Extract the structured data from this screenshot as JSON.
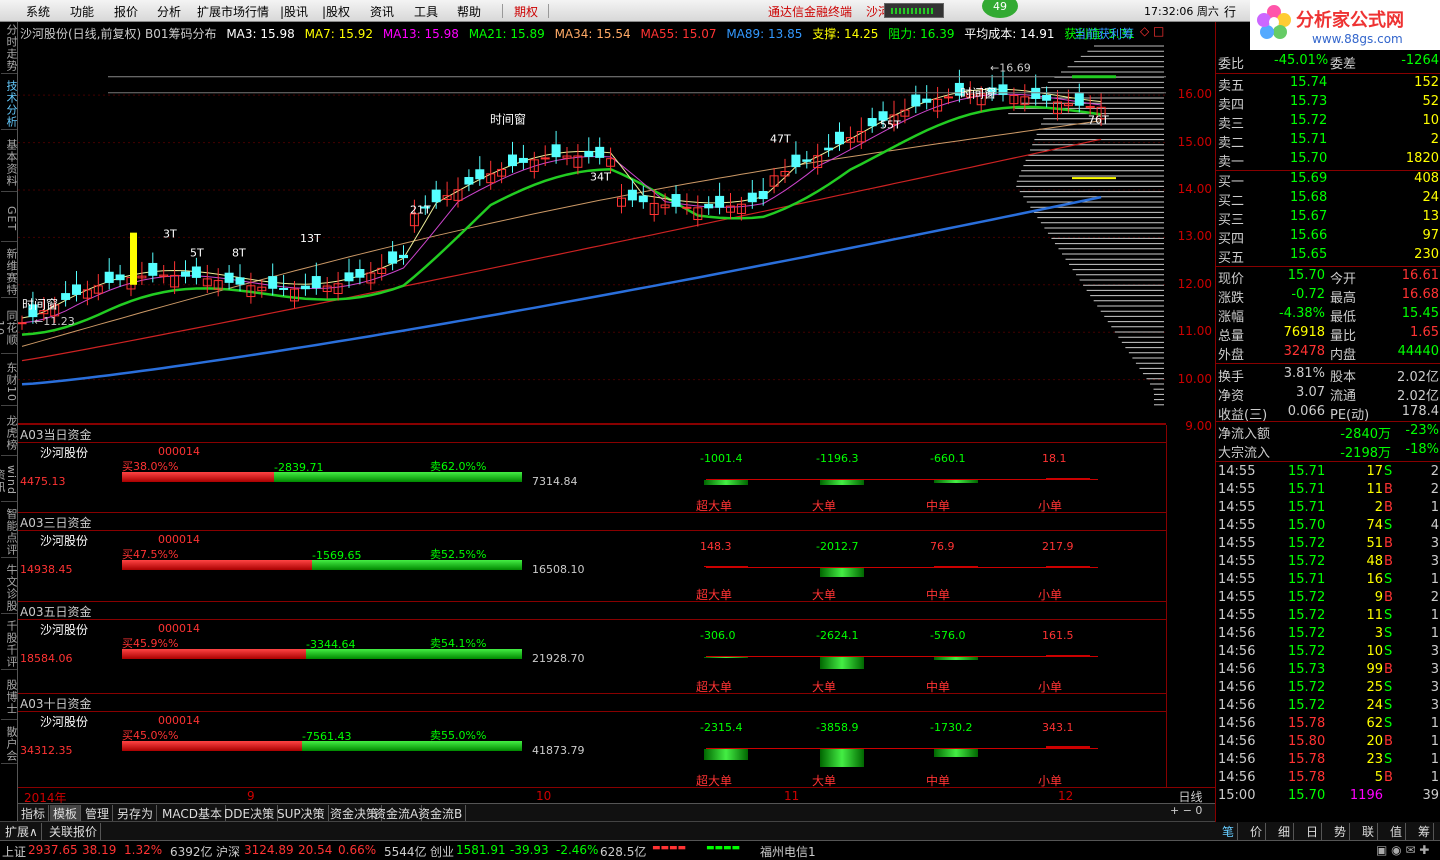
{
  "menu": {
    "items": [
      "系统",
      "功能",
      "报价",
      "分析",
      "扩展市场行情",
      "|股讯",
      "|股权",
      "资讯",
      "工具",
      "帮助"
    ],
    "option_tab": "期权",
    "broker_label": "通达信金融终端",
    "stock_short": "沙河",
    "clock": "17:32:06 周六",
    "trade_btn": "行",
    "badge": "49"
  },
  "logo": {
    "text": "分析家公式网",
    "url": "www.88gs.com"
  },
  "side_tabs": [
    "分时走势",
    "技术分析",
    "基本资料",
    "GET",
    "新维赛特",
    "同花顺10",
    "东财10",
    "龙虎榜",
    "wind资讯",
    "智能点评",
    "牛文诊股",
    "千股千评",
    "股博士",
    "散户会"
  ],
  "header": {
    "title": "沙河股份(日线,前复权) B01筹码分布",
    "ma3": "MA3: 15.98",
    "ma7": "MA7: 15.92",
    "ma13": "MA13: 15.98",
    "ma21": "MA21: 15.89",
    "ma34": "MA34: 15.54",
    "ma55": "MA55: 15.07",
    "ma89": "MA89: 13.85",
    "support": "支撑: 14.25",
    "resist": "阻力: 16.39",
    "avgcost": "平均成本: 14.91",
    "profit": "获利值: 5.31",
    "current_profit": "当前获利筹"
  },
  "price_labels": [
    "16.00",
    "15.00",
    "14.00",
    "13.00",
    "12.00",
    "11.00",
    "10.00",
    "9.00"
  ],
  "chart_annotations": {
    "high": "16.69",
    "low": "11.23",
    "t_labels": [
      "3T",
      "5T",
      "8T",
      "13T",
      "21T",
      "34T",
      "47T",
      "55T",
      "76T"
    ],
    "window_label": "时间窗"
  },
  "chart_data": {
    "type": "line",
    "title": "沙河股份(日线,前复权)",
    "x": [
      "2014-08",
      "2014-09",
      "2014-10",
      "2014-11",
      "2014-12"
    ],
    "series": [
      {
        "name": "close",
        "values": [
          11.2,
          12.7,
          14.3,
          15.9,
          15.7
        ]
      },
      {
        "name": "MA89",
        "values": [
          9.9,
          10.6,
          11.6,
          12.6,
          13.85
        ]
      }
    ],
    "ylim": [
      9,
      16.7
    ]
  },
  "quote": {
    "weibi_label": "委比",
    "weibi": "-45.01%",
    "weicha_label": "委差",
    "weicha": "-1264",
    "asks": [
      {
        "label": "卖五",
        "price": "15.74",
        "vol": "152"
      },
      {
        "label": "卖四",
        "price": "15.73",
        "vol": "52"
      },
      {
        "label": "卖三",
        "price": "15.72",
        "vol": "10"
      },
      {
        "label": "卖二",
        "price": "15.71",
        "vol": "2"
      },
      {
        "label": "卖一",
        "price": "15.70",
        "vol": "1820"
      }
    ],
    "bids": [
      {
        "label": "买一",
        "price": "15.69",
        "vol": "408"
      },
      {
        "label": "买二",
        "price": "15.68",
        "vol": "24"
      },
      {
        "label": "买三",
        "price": "15.67",
        "vol": "13"
      },
      {
        "label": "买四",
        "price": "15.66",
        "vol": "97"
      },
      {
        "label": "买五",
        "price": "15.65",
        "vol": "230"
      }
    ],
    "stats": [
      {
        "l1": "现价",
        "v1": "15.70",
        "l2": "今开",
        "v2": "16.61"
      },
      {
        "l1": "涨跌",
        "v1": "-0.72",
        "l2": "最高",
        "v2": "16.68"
      },
      {
        "l1": "涨幅",
        "v1": "-4.38%",
        "l2": "最低",
        "v2": "15.45"
      },
      {
        "l1": "总量",
        "v1": "76918",
        "l2": "量比",
        "v2": "1.65"
      },
      {
        "l1": "外盘",
        "v1": "32478",
        "l2": "内盘",
        "v2": "44440"
      },
      {
        "l1": "换手",
        "v1": "3.81%",
        "l2": "股本",
        "v2": "2.02亿"
      },
      {
        "l1": "净资",
        "v1": "3.07",
        "l2": "流通",
        "v2": "2.02亿"
      },
      {
        "l1": "收益(三)",
        "v1": "0.066",
        "l2": "PE(动)",
        "v2": "178.4"
      }
    ],
    "netflow_label": "净流入额",
    "netflow": "-2840万",
    "netflow_pct": "-23%",
    "block_label": "大宗流入",
    "block": "-2198万",
    "block_pct": "-18%"
  },
  "trades": [
    {
      "t": "14:55",
      "p": "15.71",
      "v": "17",
      "s": "S",
      "n": "2"
    },
    {
      "t": "14:55",
      "p": "15.71",
      "v": "11",
      "s": "B",
      "n": "2"
    },
    {
      "t": "14:55",
      "p": "15.71",
      "v": "2",
      "s": "B",
      "n": "1"
    },
    {
      "t": "14:55",
      "p": "15.70",
      "v": "74",
      "s": "S",
      "n": "4"
    },
    {
      "t": "14:55",
      "p": "15.72",
      "v": "51",
      "s": "B",
      "n": "3"
    },
    {
      "t": "14:55",
      "p": "15.72",
      "v": "48",
      "s": "B",
      "n": "3"
    },
    {
      "t": "14:55",
      "p": "15.71",
      "v": "16",
      "s": "S",
      "n": "1"
    },
    {
      "t": "14:55",
      "p": "15.72",
      "v": "9",
      "s": "B",
      "n": "2"
    },
    {
      "t": "14:55",
      "p": "15.72",
      "v": "11",
      "s": "S",
      "n": "1"
    },
    {
      "t": "14:56",
      "p": "15.72",
      "v": "3",
      "s": "S",
      "n": "1"
    },
    {
      "t": "14:56",
      "p": "15.72",
      "v": "10",
      "s": "S",
      "n": "3"
    },
    {
      "t": "14:56",
      "p": "15.73",
      "v": "99",
      "s": "B",
      "n": "3"
    },
    {
      "t": "14:56",
      "p": "15.72",
      "v": "25",
      "s": "S",
      "n": "3"
    },
    {
      "t": "14:56",
      "p": "15.72",
      "v": "24",
      "s": "S",
      "n": "3"
    },
    {
      "t": "14:56",
      "p": "15.78",
      "v": "62",
      "s": "S",
      "n": "1"
    },
    {
      "t": "14:56",
      "p": "15.80",
      "v": "20",
      "s": "B",
      "n": "1"
    },
    {
      "t": "14:56",
      "p": "15.78",
      "v": "23",
      "s": "S",
      "n": "1"
    },
    {
      "t": "14:56",
      "p": "15.78",
      "v": "5",
      "s": "B",
      "n": "1"
    },
    {
      "t": "15:00",
      "p": "15.70",
      "v": "1196",
      "s": "",
      "n": "39"
    }
  ],
  "fund_panels": [
    {
      "title": "A03当日资金",
      "name": "沙河股份",
      "code": "000014",
      "buy_pct": "买38.0%%",
      "sell_pct": "卖62.0%%",
      "net": "-2839.71",
      "left": "4475.13",
      "right": "7314.84",
      "buy_frac": 0.38,
      "cats": [
        {
          "label": "超大单",
          "val": "-1001.4"
        },
        {
          "label": "大单",
          "val": "-1196.3"
        },
        {
          "label": "中单",
          "val": "-660.1"
        },
        {
          "label": "小单",
          "val": "18.1"
        }
      ]
    },
    {
      "title": "A03三日资金",
      "name": "沙河股份",
      "code": "000014",
      "buy_pct": "买47.5%%",
      "sell_pct": "卖52.5%%",
      "net": "-1569.65",
      "left": "14938.45",
      "right": "16508.10",
      "buy_frac": 0.475,
      "cats": [
        {
          "label": "超大单",
          "val": "148.3"
        },
        {
          "label": "大单",
          "val": "-2012.7"
        },
        {
          "label": "中单",
          "val": "76.9"
        },
        {
          "label": "小单",
          "val": "217.9"
        }
      ]
    },
    {
      "title": "A03五日资金",
      "name": "沙河股份",
      "code": "000014",
      "buy_pct": "买45.9%%",
      "sell_pct": "卖54.1%%",
      "net": "-3344.64",
      "left": "18584.06",
      "right": "21928.70",
      "buy_frac": 0.459,
      "cats": [
        {
          "label": "超大单",
          "val": "-306.0"
        },
        {
          "label": "大单",
          "val": "-2624.1"
        },
        {
          "label": "中单",
          "val": "-576.0"
        },
        {
          "label": "小单",
          "val": "161.5"
        }
      ]
    },
    {
      "title": "A03十日资金",
      "name": "沙河股份",
      "code": "000014",
      "buy_pct": "买45.0%%",
      "sell_pct": "卖55.0%%",
      "net": "-7561.43",
      "left": "34312.35",
      "right": "41873.79",
      "buy_frac": 0.45,
      "cats": [
        {
          "label": "超大单",
          "val": "-2315.4"
        },
        {
          "label": "大单",
          "val": "-3858.9"
        },
        {
          "label": "中单",
          "val": "-1730.2"
        },
        {
          "label": "小单",
          "val": "343.1"
        }
      ]
    }
  ],
  "xaxis": {
    "labels": [
      "2014年",
      "9",
      "10",
      "11",
      "12"
    ],
    "period": "日线"
  },
  "bottom_tabs": [
    "指标",
    "模板",
    "管理",
    "另存为",
    "MACD基本",
    "DDE决策",
    "SUP决策",
    "资金决策",
    "资金流A",
    "资金流B"
  ],
  "extra_tabs": [
    "扩展∧",
    "关联报价"
  ],
  "right_bottom_tabs": [
    "笔",
    "价",
    "细",
    "日",
    "势",
    "联",
    "值",
    "筹"
  ],
  "status": {
    "sh_label": "上证",
    "sh": "2937.65",
    "sh_chg": "38.19",
    "sh_pct": "1.32%",
    "sh_amt": "6392亿",
    "sz_label": "沪深",
    "sz": "3124.89",
    "sz_chg": "20.54",
    "sz_pct": "0.66%",
    "sz_amt": "5544亿",
    "cy_label": "创业",
    "cy": "1581.91",
    "cy_chg": "-39.93",
    "cy_pct": "-2.46%",
    "cy_amt": "628.5亿",
    "server": "福州电信1"
  }
}
